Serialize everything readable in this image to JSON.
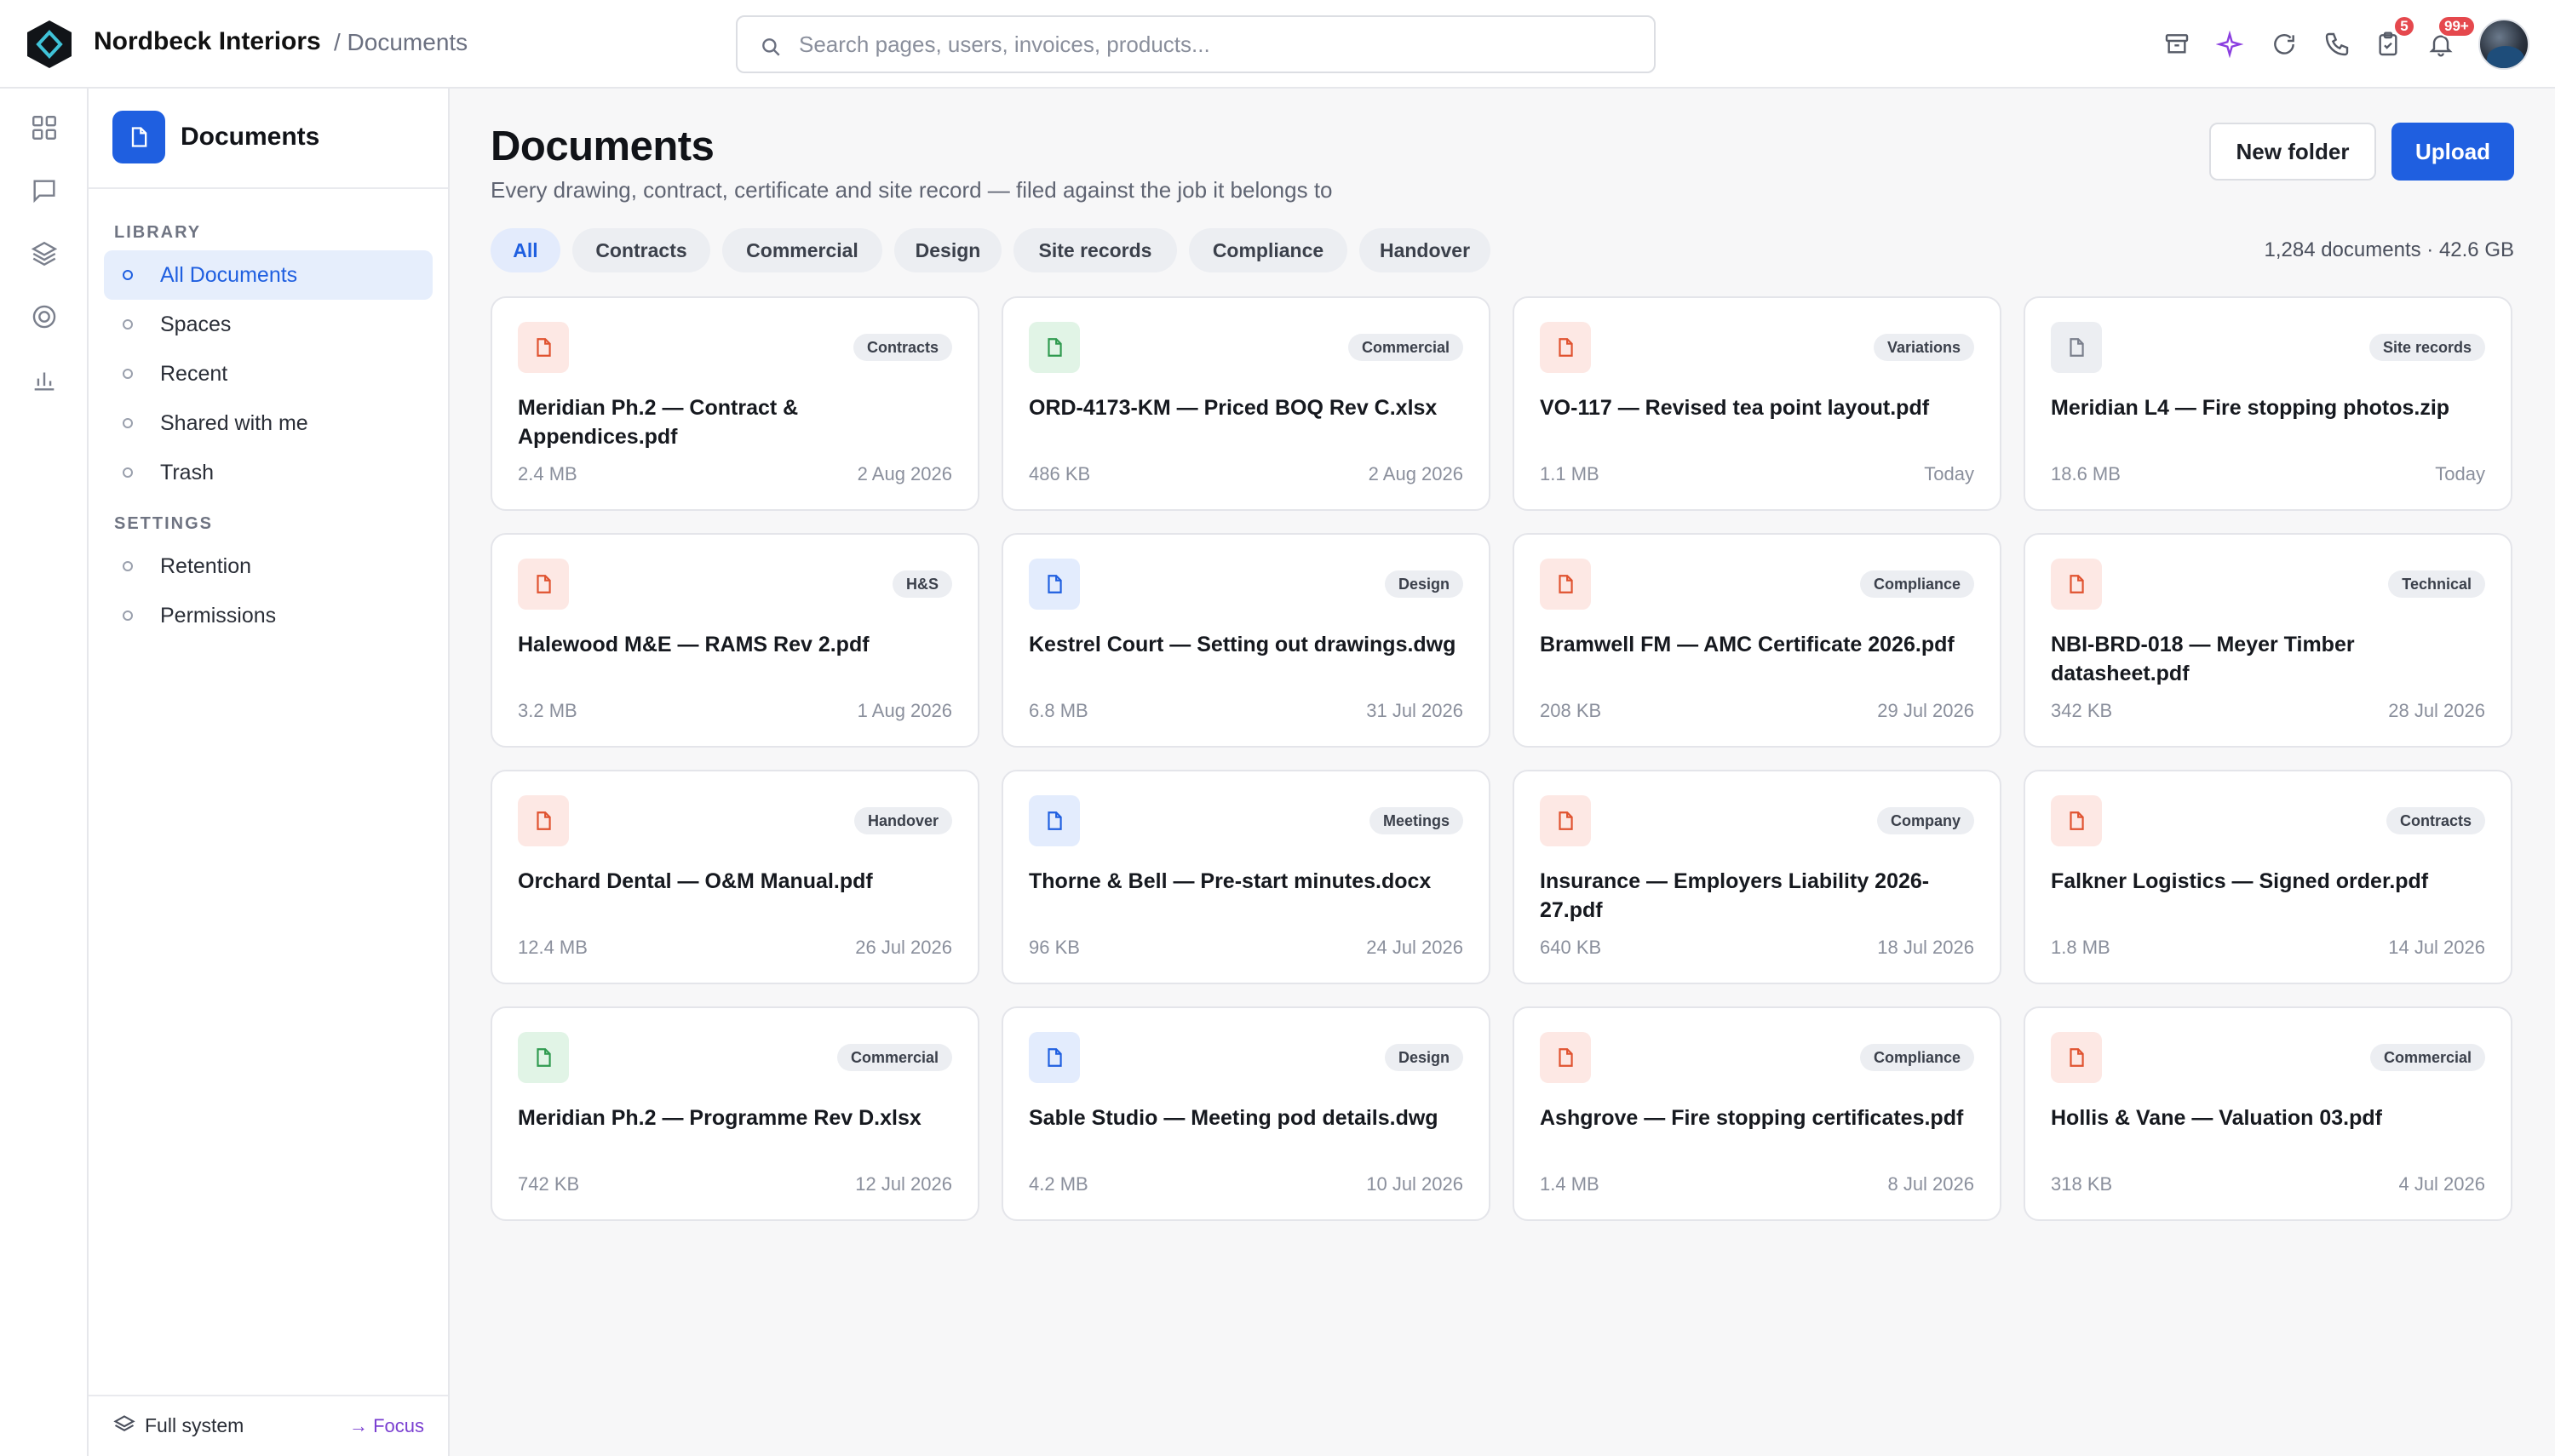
{
  "app": {
    "brand": "Nordbeck Interiors",
    "crumb": "/ Documents"
  },
  "search": {
    "placeholder": "Search pages, users, invoices, products..."
  },
  "topbar": {
    "badge_tasks": "5",
    "badge_notifications": "99+"
  },
  "sidebar": {
    "title": "Documents",
    "library_label": "LIBRARY",
    "library_items": [
      "All Documents",
      "Spaces",
      "Recent",
      "Shared with me",
      "Trash"
    ],
    "settings_label": "SETTINGS",
    "settings_items": [
      "Retention",
      "Permissions"
    ],
    "footer_left": "Full system",
    "footer_right": "→ Focus"
  },
  "main": {
    "title": "Documents",
    "subtitle": "Every drawing, contract, certificate and site record — filed against the job it belongs to",
    "new_folder": "New folder",
    "upload": "Upload",
    "filters": [
      "All",
      "Contracts",
      "Commercial",
      "Design",
      "Site records",
      "Compliance",
      "Handover"
    ],
    "active_filter": "All",
    "count": "1,284 documents · 42.6 GB"
  },
  "colors": {
    "accent": "#1f5fe0",
    "pdf": "#e0522f",
    "sheet": "#2f9a4f",
    "doc": "#1f5fe0",
    "archive": "#7a7f8c"
  },
  "documents": [
    {
      "name": "Meridian Ph.2 — Contract & Appendices.pdf",
      "tag": "Contracts",
      "size": "2.4 MB",
      "date": "2 Aug 2026",
      "icon": "pdf-file-icon"
    },
    {
      "name": "ORD-4173-KM — Priced BOQ Rev C.xlsx",
      "tag": "Commercial",
      "size": "486 KB",
      "date": "2 Aug 2026",
      "icon": "spreadsheet-file-icon"
    },
    {
      "name": "VO-117 — Revised tea point layout.pdf",
      "tag": "Variations",
      "size": "1.1 MB",
      "date": "Today",
      "icon": "pdf-file-icon"
    },
    {
      "name": "Meridian L4 — Fire stopping photos.zip",
      "tag": "Site records",
      "size": "18.6 MB",
      "date": "Today",
      "icon": "archive-file-icon"
    },
    {
      "name": "Halewood M&E — RAMS Rev 2.pdf",
      "tag": "H&S",
      "size": "3.2 MB",
      "date": "1 Aug 2026",
      "icon": "pdf-file-icon"
    },
    {
      "name": "Kestrel Court — Setting out drawings.dwg",
      "tag": "Design",
      "size": "6.8 MB",
      "date": "31 Jul 2026",
      "icon": "drawing-file-icon"
    },
    {
      "name": "Bramwell FM — AMC Certificate 2026.pdf",
      "tag": "Compliance",
      "size": "208 KB",
      "date": "29 Jul 2026",
      "icon": "pdf-file-icon"
    },
    {
      "name": "NBI-BRD-018 — Meyer Timber datasheet.pdf",
      "tag": "Technical",
      "size": "342 KB",
      "date": "28 Jul 2026",
      "icon": "pdf-file-icon"
    },
    {
      "name": "Orchard Dental — O&M Manual.pdf",
      "tag": "Handover",
      "size": "12.4 MB",
      "date": "26 Jul 2026",
      "icon": "pdf-file-icon"
    },
    {
      "name": "Thorne & Bell — Pre-start minutes.docx",
      "tag": "Meetings",
      "size": "96 KB",
      "date": "24 Jul 2026",
      "icon": "word-file-icon"
    },
    {
      "name": "Insurance — Employers Liability 2026-27.pdf",
      "tag": "Company",
      "size": "640 KB",
      "date": "18 Jul 2026",
      "icon": "pdf-file-icon"
    },
    {
      "name": "Falkner Logistics — Signed order.pdf",
      "tag": "Contracts",
      "size": "1.8 MB",
      "date": "14 Jul 2026",
      "icon": "pdf-file-icon"
    },
    {
      "name": "Meridian Ph.2 — Programme Rev D.xlsx",
      "tag": "Commercial",
      "size": "742 KB",
      "date": "12 Jul 2026",
      "icon": "spreadsheet-file-icon"
    },
    {
      "name": "Sable Studio — Meeting pod details.dwg",
      "tag": "Design",
      "size": "4.2 MB",
      "date": "10 Jul 2026",
      "icon": "drawing-file-icon"
    },
    {
      "name": "Ashgrove — Fire stopping certificates.pdf",
      "tag": "Compliance",
      "size": "1.4 MB",
      "date": "8 Jul 2026",
      "icon": "pdf-file-icon"
    },
    {
      "name": "Hollis & Vane — Valuation 03.pdf",
      "tag": "Commercial",
      "size": "318 KB",
      "date": "4 Jul 2026",
      "icon": "pdf-file-icon"
    }
  ]
}
